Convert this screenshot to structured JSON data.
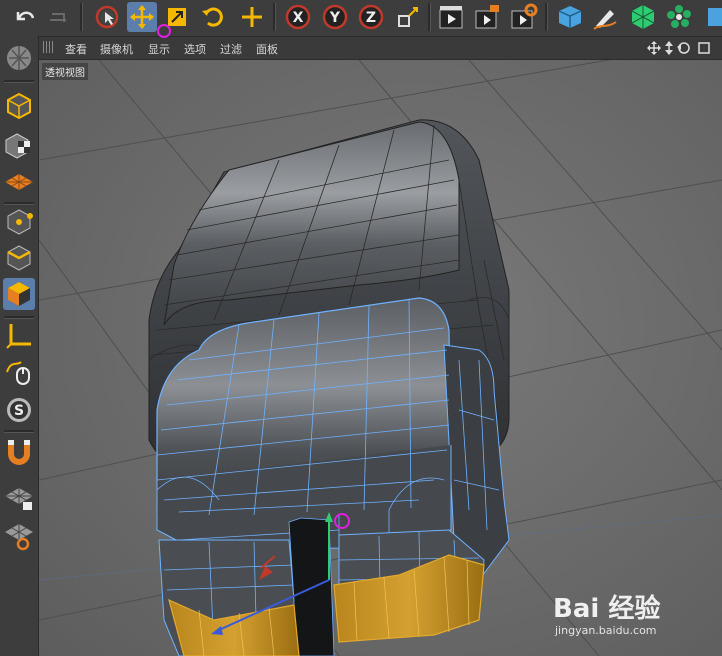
{
  "viewport_menu": [
    "查看",
    "摄像机",
    "显示",
    "选项",
    "过滤",
    "面板"
  ],
  "view_label": "透视视图",
  "watermark": {
    "brand": "Bai 经验",
    "url": "jingyan.baidu.com"
  },
  "colors": {
    "active_tool": "#5b7eab",
    "selection_wire": "#6fb2ff",
    "selected_polygons": "#e3a92c",
    "viewport_bg": "#6b6b6b"
  },
  "toolbar_icons": [
    "undo-icon",
    "redo-icon",
    "live-selection-icon",
    "move-icon",
    "scale-icon",
    "rotate-icon",
    "add-icon",
    "x-axis-icon",
    "y-axis-icon",
    "z-axis-icon",
    "coordinate-system-icon",
    "render-view-icon",
    "render-to-picture-viewer-icon",
    "render-settings-icon",
    "cube-icon",
    "pen-icon",
    "subdivision-icon",
    "cloner-icon"
  ],
  "left_icons": [
    "make-editable-icon",
    "texture-mode-icon",
    "workplane-icon",
    "points-mode-icon",
    "edges-mode-icon",
    "polygons-mode-icon",
    "axis-mode-icon",
    "tweak-icon",
    "solo-icon",
    "snapping-icon",
    "lock-workplane-icon",
    "workplane-align-icon"
  ]
}
